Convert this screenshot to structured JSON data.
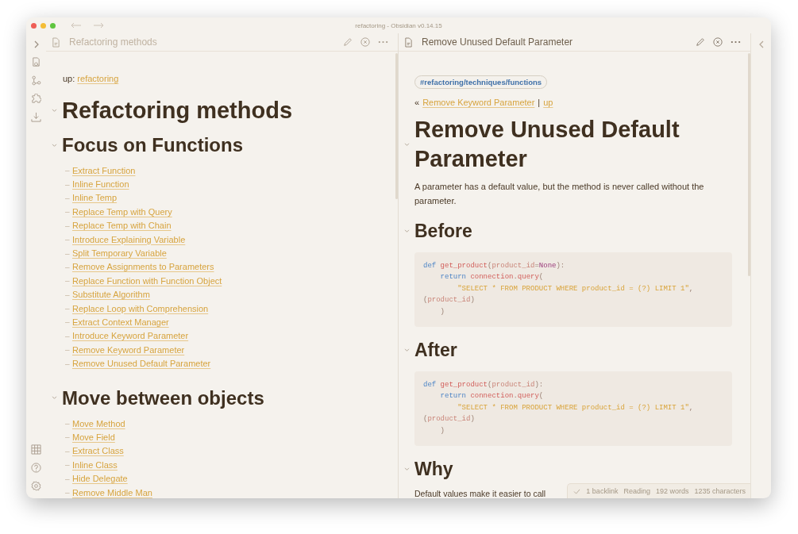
{
  "window": {
    "title": "refactoring - Obsidian v0.14.15"
  },
  "left_pane": {
    "title": "Refactoring methods",
    "up_label": "up:",
    "up_link": "refactoring",
    "blocks": [
      {
        "kind": "h1",
        "text": "Refactoring methods"
      },
      {
        "kind": "h2",
        "text": "Focus on Functions"
      },
      {
        "kind": "list",
        "items": [
          {
            "bullet": "–",
            "text": "Extract Function"
          },
          {
            "bullet": "–",
            "text": "Inline Function"
          },
          {
            "bullet": "–",
            "text": "Inline Temp"
          },
          {
            "bullet": "–",
            "text": "Replace Temp with Query"
          },
          {
            "bullet": "–",
            "text": "Replace Temp with Chain"
          },
          {
            "bullet": "–",
            "text": "Introduce Explaining Variable"
          },
          {
            "bullet": "–",
            "text": "Split Temporary Variable"
          },
          {
            "bullet": "–",
            "text": "Remove Assignments to Parameters"
          },
          {
            "bullet": "–",
            "text": "Replace Function with Function Object"
          },
          {
            "bullet": "–",
            "text": "Substitute Algorithm"
          },
          {
            "bullet": "–",
            "text": "Replace Loop with Comprehension"
          },
          {
            "bullet": "–",
            "text": "Extract Context Manager"
          },
          {
            "bullet": "–",
            "text": "Introduce Keyword Parameter"
          },
          {
            "bullet": "–",
            "text": "Remove Keyword Parameter"
          },
          {
            "bullet": "–",
            "text": "Remove Unused Default Parameter"
          }
        ]
      },
      {
        "kind": "h2",
        "text": "Move between objects"
      },
      {
        "kind": "list",
        "items": [
          {
            "bullet": "–",
            "text": "Move Method"
          },
          {
            "bullet": "–",
            "text": "Move Field"
          },
          {
            "bullet": "–",
            "text": "Extract Class"
          },
          {
            "bullet": "–",
            "text": "Inline Class"
          },
          {
            "bullet": "–",
            "text": "Hide Delegate"
          },
          {
            "bullet": "–",
            "text": "Remove Middle Man"
          }
        ]
      }
    ]
  },
  "right_pane": {
    "title": "Remove Unused Default Parameter",
    "tag": "#refactoring/techniques/functions",
    "nav": {
      "prefix": "«",
      "previous": "Remove Keyword Parameter",
      "separator": "|",
      "next": "up"
    },
    "blocks": [
      {
        "kind": "h1",
        "text": "Remove Unused Default Parameter"
      },
      {
        "kind": "paragraph",
        "text": "A parameter has a default value, but the method is never called without the parameter."
      },
      {
        "kind": "h2",
        "text": "Before"
      },
      {
        "kind": "code",
        "lines": [
          [
            {
              "kind": "keyword",
              "text": "def "
            },
            {
              "kind": "function",
              "text": "get_product"
            },
            {
              "kind": "punct",
              "text": "("
            },
            {
              "kind": "param",
              "text": "product_id"
            },
            {
              "kind": "punct",
              "text": "="
            },
            {
              "kind": "constant",
              "text": "None"
            },
            {
              "kind": "punct",
              "text": "):"
            }
          ],
          [
            {
              "kind": "keyword",
              "text": "    return "
            },
            {
              "kind": "function",
              "text": "connection"
            },
            {
              "kind": "punct",
              "text": "."
            },
            {
              "kind": "function",
              "text": "query"
            },
            {
              "kind": "punct",
              "text": "("
            }
          ],
          [
            {
              "kind": "string",
              "text": "        \"SELECT * FROM PRODUCT WHERE product_id = (?) LIMIT 1\""
            },
            {
              "kind": "punct",
              "text": ","
            }
          ],
          [
            {
              "kind": "punct",
              "text": "("
            },
            {
              "kind": "param",
              "text": "product_id"
            },
            {
              "kind": "punct",
              "text": ")"
            }
          ],
          [
            {
              "kind": "punct",
              "text": "    )"
            }
          ]
        ]
      },
      {
        "kind": "h2",
        "text": "After"
      },
      {
        "kind": "code",
        "lines": [
          [
            {
              "kind": "keyword",
              "text": "def "
            },
            {
              "kind": "function",
              "text": "get_product"
            },
            {
              "kind": "punct",
              "text": "("
            },
            {
              "kind": "param",
              "text": "product_id"
            },
            {
              "kind": "punct",
              "text": "):"
            }
          ],
          [
            {
              "kind": "keyword",
              "text": "    return "
            },
            {
              "kind": "function",
              "text": "connection"
            },
            {
              "kind": "punct",
              "text": "."
            },
            {
              "kind": "function",
              "text": "query"
            },
            {
              "kind": "punct",
              "text": "("
            }
          ],
          [
            {
              "kind": "string",
              "text": "        \"SELECT * FROM PRODUCT WHERE product_id = (?) LIMIT 1\""
            },
            {
              "kind": "punct",
              "text": ","
            }
          ],
          [
            {
              "kind": "punct",
              "text": "("
            },
            {
              "kind": "param",
              "text": "product_id"
            },
            {
              "kind": "punct",
              "text": ")"
            }
          ],
          [
            {
              "kind": "punct",
              "text": "    )"
            }
          ]
        ]
      },
      {
        "kind": "h2",
        "text": "Why"
      },
      {
        "kind": "paragraph",
        "text": "Default values make it easier to call"
      }
    ]
  },
  "status_bar": {
    "items": [
      "1 backlink",
      "Reading",
      "192 words",
      "1235 characters"
    ]
  }
}
